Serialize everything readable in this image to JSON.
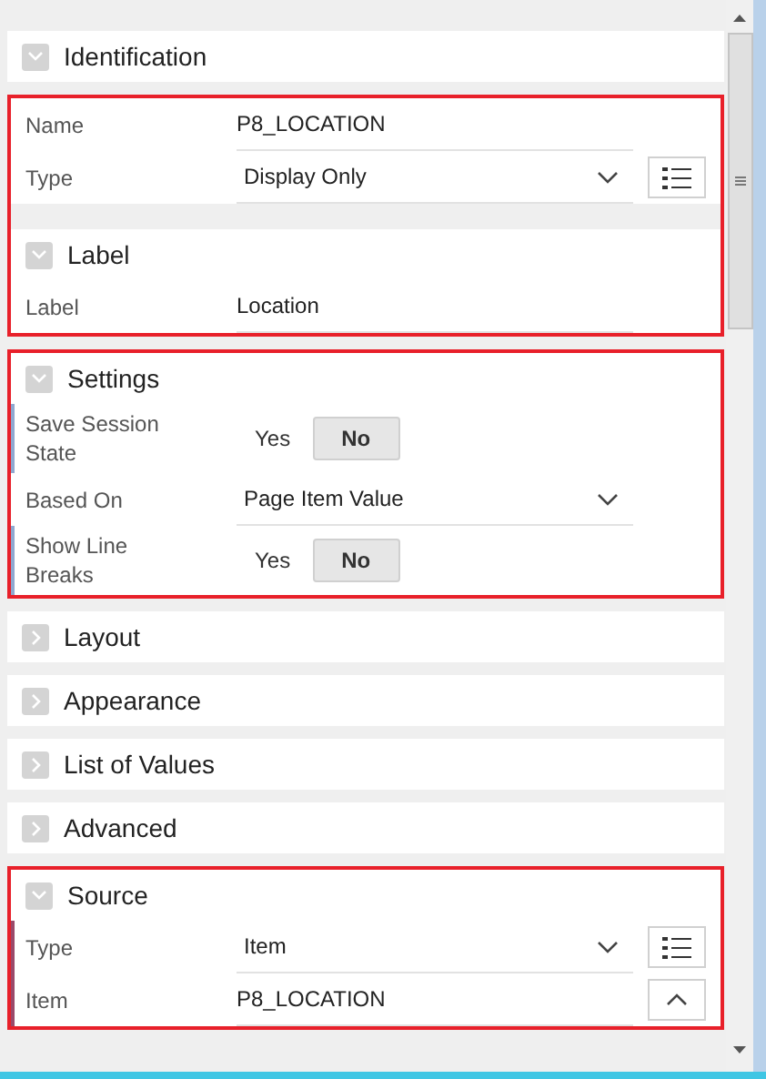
{
  "groups": [
    {
      "highlighted": false,
      "items": [
        {
          "kind": "header",
          "title": "Identification",
          "expanded": true
        }
      ]
    },
    {
      "highlighted": true,
      "items": [
        {
          "kind": "text",
          "label": "Name",
          "value": "P8_LOCATION"
        },
        {
          "kind": "select",
          "label": "Type",
          "value": "Display Only",
          "list_button": true
        },
        {
          "kind": "header",
          "title": "Label",
          "expanded": true
        },
        {
          "kind": "text",
          "label": "Label",
          "value": "Location"
        }
      ]
    },
    {
      "highlighted": true,
      "items": [
        {
          "kind": "header",
          "title": "Settings",
          "expanded": true
        },
        {
          "kind": "switch",
          "label": "Save Session State",
          "color": "#8fa8d0",
          "options": [
            {
              "label": "Yes",
              "selected": false
            },
            {
              "label": "No",
              "selected": true
            }
          ]
        },
        {
          "kind": "select",
          "label": "Based On",
          "value": "Page Item Value"
        },
        {
          "kind": "switch",
          "label": "Show Line Breaks",
          "color": "#8fa8d0",
          "options": [
            {
              "label": "Yes",
              "selected": false
            },
            {
              "label": "No",
              "selected": true
            }
          ]
        }
      ]
    },
    {
      "highlighted": false,
      "items": [
        {
          "kind": "header",
          "title": "Layout",
          "expanded": false
        },
        {
          "kind": "header",
          "title": "Appearance",
          "expanded": false
        },
        {
          "kind": "header",
          "title": "List of Values",
          "expanded": false
        },
        {
          "kind": "header",
          "title": "Advanced",
          "expanded": false
        }
      ]
    },
    {
      "highlighted": true,
      "items": [
        {
          "kind": "header",
          "title": "Source",
          "expanded": true
        },
        {
          "kind": "select",
          "label": "Type",
          "value": "Item",
          "color": "#9a4a6a",
          "list_button": true
        },
        {
          "kind": "text",
          "label": "Item",
          "value": "P8_LOCATION",
          "color": "#9a4a6a",
          "collapse_button": true
        }
      ]
    }
  ]
}
